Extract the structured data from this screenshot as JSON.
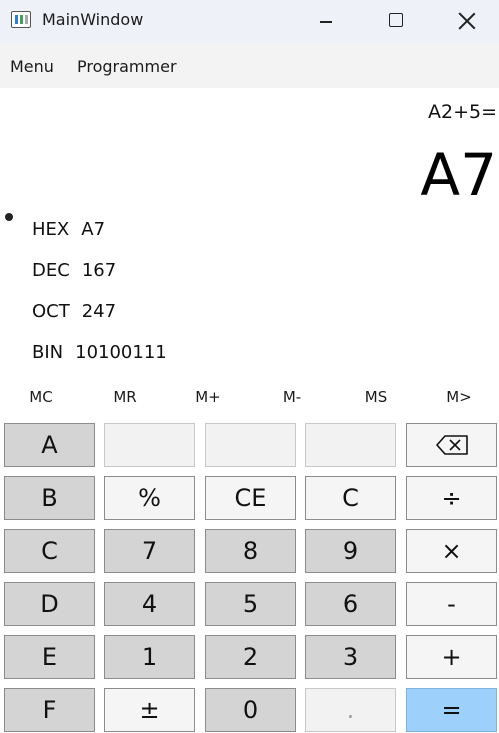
{
  "window": {
    "title": "MainWindow",
    "icon": "app-window-icon",
    "controls": [
      "minimize-icon",
      "maximize-icon",
      "close-icon"
    ]
  },
  "menu": {
    "items": [
      "Menu",
      "Programmer"
    ]
  },
  "display": {
    "expression": "A2+5=",
    "result": "A7"
  },
  "radix": [
    {
      "label": "HEX",
      "value": "A7"
    },
    {
      "label": "DEC",
      "value": "167"
    },
    {
      "label": "OCT",
      "value": "247"
    },
    {
      "label": "BIN",
      "value": "10100111"
    }
  ],
  "memory": [
    "MC",
    "MR",
    "M+",
    "M-",
    "MS",
    "M>"
  ],
  "keypad": {
    "rows": [
      [
        "A",
        "",
        "",
        "",
        "⌫"
      ],
      [
        "B",
        "%",
        "CE",
        "C",
        "÷"
      ],
      [
        "C",
        "7",
        "8",
        "9",
        "×"
      ],
      [
        "D",
        "4",
        "5",
        "6",
        "-"
      ],
      [
        "E",
        "1",
        "2",
        "3",
        "+"
      ],
      [
        "F",
        "±",
        "0",
        ".",
        "="
      ]
    ]
  },
  "colors": {
    "titlebar": "#eef1f8",
    "menubar": "#f3f3f3",
    "key_gray": "#d4d4d4",
    "key_light": "#f5f5f5",
    "equals": "#9dd0fa"
  }
}
